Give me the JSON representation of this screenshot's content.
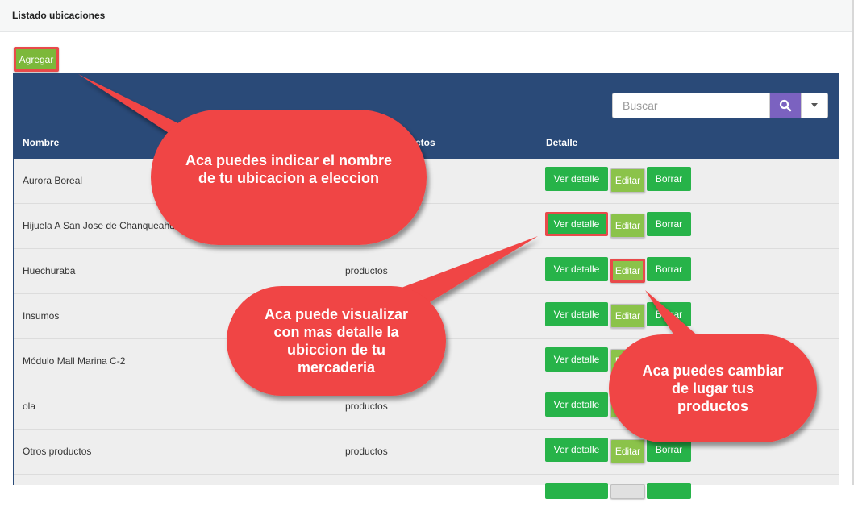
{
  "header": {
    "title": "Listado ubicaciones"
  },
  "toolbar": {
    "add_label": "Agregar"
  },
  "search": {
    "placeholder": "Buscar"
  },
  "table": {
    "columns": {
      "nombre": "Nombre",
      "productos": "ctos",
      "detalle": "Detalle"
    },
    "rows": [
      {
        "name": "Aurora Boreal",
        "products": ""
      },
      {
        "name": "Hijuela A San Jose de Chanqueahu",
        "products": ""
      },
      {
        "name": "Huechuraba",
        "products": "productos"
      },
      {
        "name": "Insumos",
        "products": ""
      },
      {
        "name": "Módulo Mall Marina C-2",
        "products": ""
      },
      {
        "name": "ola",
        "products": "productos"
      },
      {
        "name": "Otros productos",
        "products": "productos"
      }
    ],
    "actions": {
      "ver": "Ver detalle",
      "editar": "Editar",
      "borrar": "Borrar"
    }
  },
  "callouts": {
    "nombre": "Aca puedes indicar el nombre de tu ubicacion a eleccion",
    "detalle": "Aca puede visualizar con mas detalle la ubiccion de tu mercaderia",
    "editar": "Aca puedes cambiar de lugar tus productos"
  },
  "colors": {
    "panel": "#2a4a78",
    "green": "#27b349",
    "edit_green": "#8bc34a",
    "callout": "#f04444",
    "search_btn": "#7b62c0"
  }
}
